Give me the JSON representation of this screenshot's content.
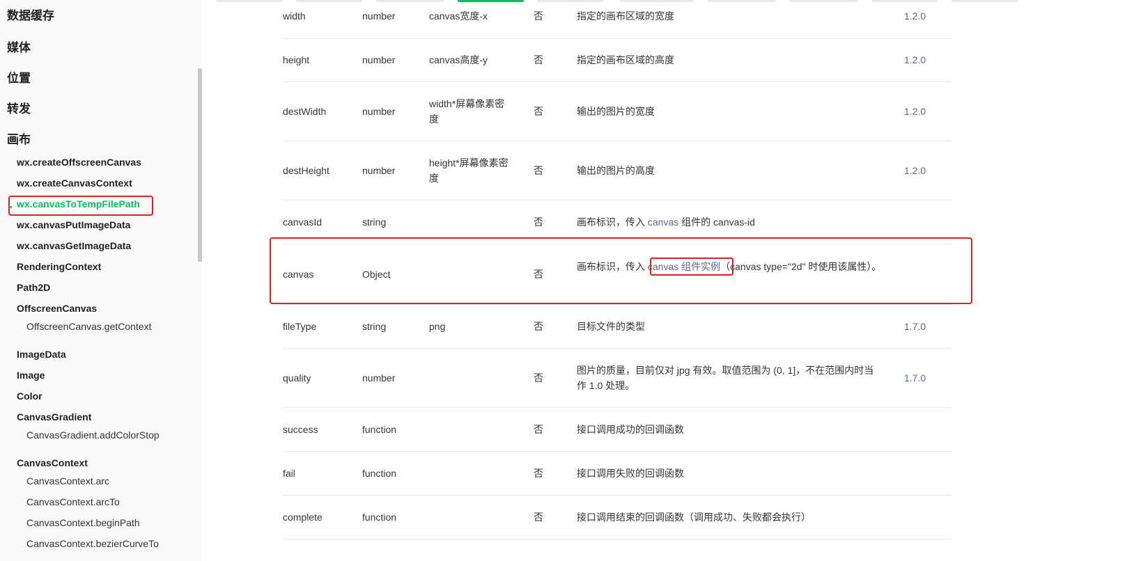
{
  "sidebar": {
    "partial_top": "数据缓存",
    "categories": [
      "媒体",
      "位置",
      "转发",
      "画布"
    ],
    "apis": [
      "wx.createOffscreenCanvas",
      "wx.createCanvasContext",
      "wx.canvasToTempFilePath",
      "wx.canvasPutImageData",
      "wx.canvasGetImageData",
      "RenderingContext",
      "Path2D",
      "OffscreenCanvas",
      "OffscreenCanvas.getContext",
      "ImageData",
      "Image",
      "Color",
      "CanvasGradient",
      "CanvasGradient.addColorStop",
      "CanvasContext",
      "CanvasContext.arc",
      "CanvasContext.arcTo",
      "CanvasContext.beginPath",
      "CanvasContext.bezierCurveTo"
    ],
    "active_item": "wx.canvasToTempFilePath"
  },
  "table": {
    "rows": [
      {
        "name": "width",
        "type": "number",
        "default": "canvas宽度-x",
        "required": "否",
        "desc": "指定的画布区域的宽度",
        "version": "1.2.0"
      },
      {
        "name": "height",
        "type": "number",
        "default": "canvas高度-y",
        "required": "否",
        "desc": "指定的画布区域的高度",
        "version": "1.2.0"
      },
      {
        "name": "destWidth",
        "type": "number",
        "default": "width*屏幕像素密度",
        "required": "否",
        "desc": "输出的图片的宽度",
        "version": "1.2.0"
      },
      {
        "name": "destHeight",
        "type": "number",
        "default": "height*屏幕像素密度",
        "required": "否",
        "desc": "输出的图片的高度",
        "version": "1.2.0"
      },
      {
        "name": "canvasId",
        "type": "string",
        "default": "",
        "required": "否",
        "desc_pre": "画布标识，传入 ",
        "desc_link": "canvas",
        "desc_post": " 组件的 canvas-id",
        "version": ""
      },
      {
        "name": "canvas",
        "type": "Object",
        "default": "",
        "required": "否",
        "desc_pre": "画布标识，传入 ",
        "desc_link": "canvas 组件实例",
        "desc_post": "（canvas type=\"2d\" 时使用该属性）。",
        "version": ""
      },
      {
        "name": "fileType",
        "type": "string",
        "default": "png",
        "required": "否",
        "desc": "目标文件的类型",
        "version": "1.7.0"
      },
      {
        "name": "quality",
        "type": "number",
        "default": "",
        "required": "否",
        "desc": "图片的质量，目前仅对 jpg 有效。取值范围为 (0, 1]，不在范围内时当作 1.0 处理。",
        "version": "1.7.0"
      },
      {
        "name": "success",
        "type": "function",
        "default": "",
        "required": "否",
        "desc": "接口调用成功的回调函数",
        "version": ""
      },
      {
        "name": "fail",
        "type": "function",
        "default": "",
        "required": "否",
        "desc": "接口调用失败的回调函数",
        "version": ""
      },
      {
        "name": "complete",
        "type": "function",
        "default": "",
        "required": "否",
        "desc": "接口调用结束的回调函数（调用成功、失败都会执行）",
        "version": ""
      }
    ]
  },
  "colors": {
    "accent": "#07c160",
    "link": "#576b95",
    "highlight_box": "#e02020"
  }
}
